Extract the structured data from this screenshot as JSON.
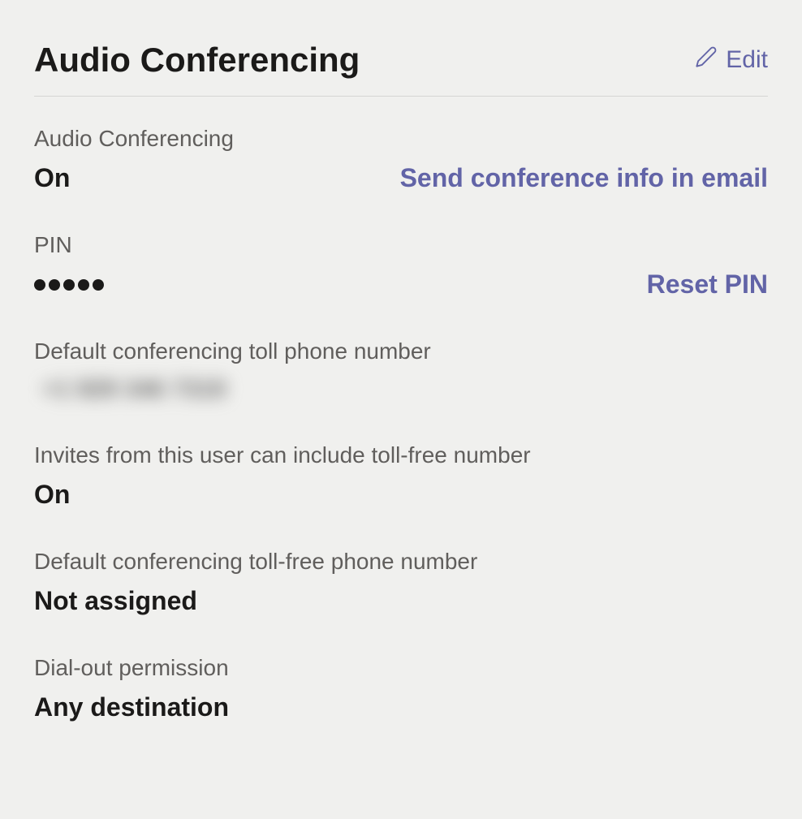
{
  "header": {
    "title": "Audio Conferencing",
    "edit_label": "Edit"
  },
  "fields": {
    "audio_conf": {
      "label": "Audio Conferencing",
      "value": "On",
      "action": "Send conference info in email"
    },
    "pin": {
      "label": "PIN",
      "masked_count": 5,
      "action": "Reset PIN"
    },
    "toll_number": {
      "label": "Default conferencing toll phone number",
      "value": "+1 929 346 7319"
    },
    "include_tollfree": {
      "label": "Invites from this user can include toll-free number",
      "value": "On"
    },
    "tollfree_number": {
      "label": "Default conferencing toll-free phone number",
      "value": "Not assigned"
    },
    "dialout": {
      "label": "Dial-out permission",
      "value": "Any destination"
    }
  }
}
